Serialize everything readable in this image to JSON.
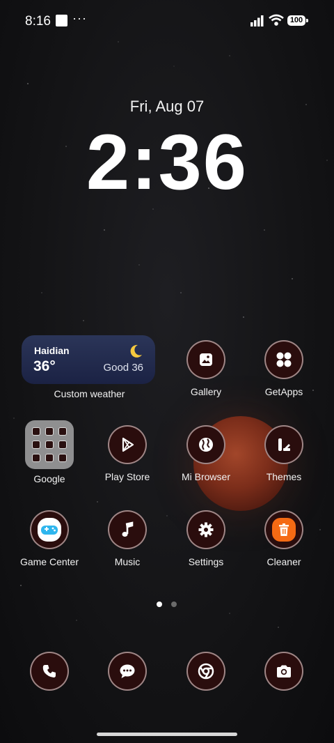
{
  "status_bar": {
    "time": "8:16",
    "overflow": "···",
    "battery": "100",
    "icons": [
      "signal-icon",
      "wifi-icon",
      "battery-icon"
    ]
  },
  "clock": {
    "date": "Fri, Aug 07",
    "time": "2:36"
  },
  "weather_widget": {
    "city": "Haidian",
    "temp": "36°",
    "aqi": "Good 36",
    "label": "Custom weather",
    "icon": "moon-icon"
  },
  "apps": {
    "gallery": "Gallery",
    "getapps": "GetApps",
    "google": "Google",
    "play_store": "Play Store",
    "mi_browser": "Mi Browser",
    "themes": "Themes",
    "game_center": "Game Center",
    "music": "Music",
    "settings": "Settings",
    "cleaner": "Cleaner"
  },
  "dock": [
    "phone-icon",
    "messages-icon",
    "chrome-icon",
    "camera-icon"
  ],
  "pager": {
    "pages": 2,
    "active": 0
  },
  "colors": {
    "icon_bg": "#2a0d0d",
    "weather_bg": "#1b2244",
    "cleaner": "#f56a14",
    "moon": "#7b2d1a"
  }
}
